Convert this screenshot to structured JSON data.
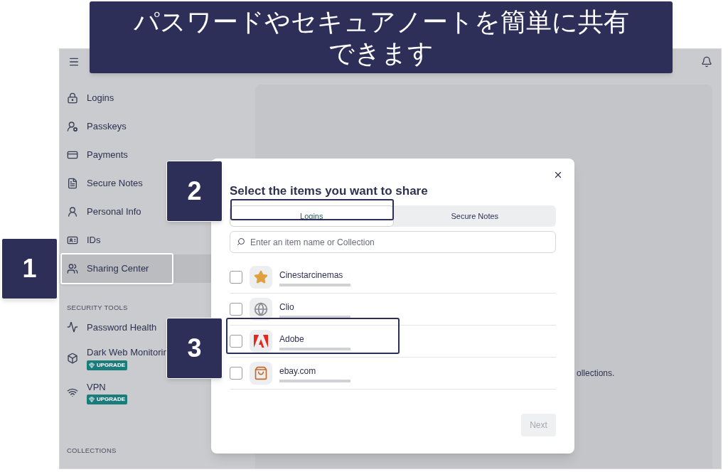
{
  "banner": {
    "lines": [
      "パスワードやセキュアノートを簡単に共有",
      "できます"
    ]
  },
  "sidebar": {
    "items": [
      {
        "label": "Logins",
        "selected": false
      },
      {
        "label": "Passkeys",
        "selected": false
      },
      {
        "label": "Payments",
        "selected": false
      },
      {
        "label": "Secure Notes",
        "selected": false
      },
      {
        "label": "Personal Info",
        "selected": false
      },
      {
        "label": "IDs",
        "selected": false
      },
      {
        "label": "Sharing Center",
        "selected": true
      }
    ],
    "security_title": "SECURITY TOOLS",
    "tools": [
      {
        "label": "Password Health"
      },
      {
        "label": "Dark Web Monitorin",
        "badge": "UPGRADE"
      },
      {
        "label": "VPN",
        "badge": "UPGRADE"
      }
    ],
    "collections_title": "COLLECTIONS"
  },
  "main": {
    "text": "ollections."
  },
  "modal": {
    "title": "Select the items you want to share",
    "tabs": [
      {
        "label": "Logins",
        "selected": true
      },
      {
        "label": "Secure Notes",
        "selected": false
      }
    ],
    "search": {
      "placeholder": "Enter an item name or Collection"
    },
    "items": [
      {
        "name": "Cinestarcinemas",
        "checked": false
      },
      {
        "name": "Clio",
        "checked": false
      },
      {
        "name": "Adobe",
        "checked": false
      },
      {
        "name": "ebay.com",
        "checked": false
      }
    ],
    "next": {
      "label": "Next",
      "disabled": true
    }
  },
  "callouts": [
    "1",
    "2",
    "3"
  ]
}
